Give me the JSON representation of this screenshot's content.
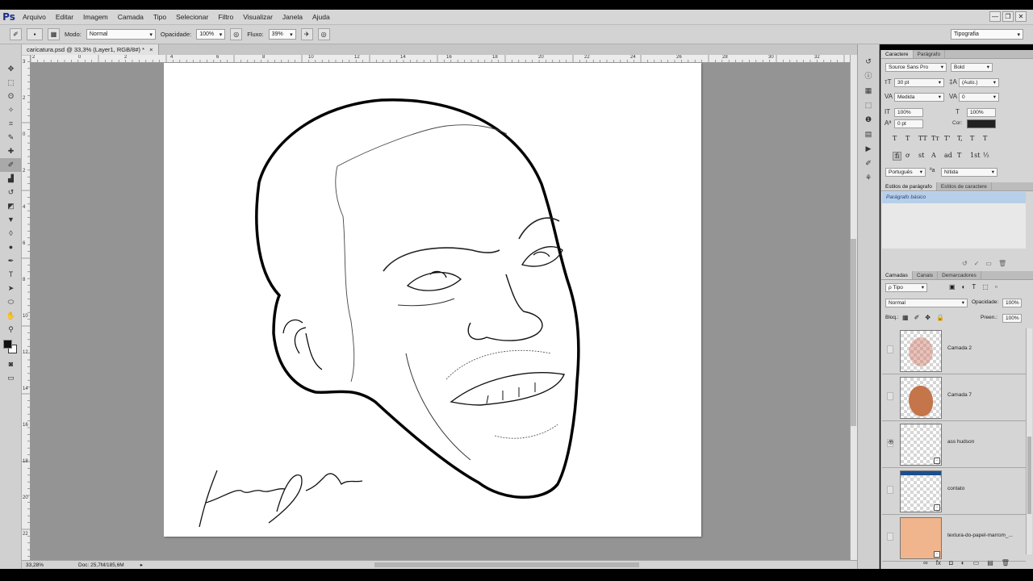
{
  "app": {
    "logo": "Ps"
  },
  "menu": [
    "Arquivo",
    "Editar",
    "Imagem",
    "Camada",
    "Tipo",
    "Selecionar",
    "Filtro",
    "Visualizar",
    "Janela",
    "Ajuda"
  ],
  "window_controls": [
    "—",
    "❐",
    "✕"
  ],
  "options_bar": {
    "mode_label": "Modo:",
    "mode_value": "Normal",
    "opacity_label": "Opacidade:",
    "opacity_value": "100%",
    "flow_label": "Fluxo:",
    "flow_value": "39%",
    "workspace": "Tipografia"
  },
  "document": {
    "tab_title": "caricatura.psd @ 33,3% (Layer1, RGB/8#) *",
    "zoom": "33,28%",
    "doc_info": "Doc: 25,7M/185,6M"
  },
  "ruler_top_labels": [
    "2",
    "0",
    "2",
    "4",
    "6",
    "8",
    "10",
    "12",
    "14",
    "16",
    "18",
    "20",
    "22",
    "24",
    "26",
    "28",
    "30",
    "32"
  ],
  "ruler_left_labels": [
    "3",
    "2",
    "0",
    "2",
    "4",
    "6",
    "8",
    "10",
    "12",
    "14",
    "16",
    "18",
    "20",
    "22"
  ],
  "tools": [
    {
      "name": "move-tool",
      "glyph": "✥"
    },
    {
      "name": "marquee-tool",
      "glyph": "⬚"
    },
    {
      "name": "lasso-tool",
      "glyph": "ʘ"
    },
    {
      "name": "quick-select-tool",
      "glyph": "✧"
    },
    {
      "name": "crop-tool",
      "glyph": "⌗"
    },
    {
      "name": "eyedropper-tool",
      "glyph": "✎"
    },
    {
      "name": "healing-tool",
      "glyph": "✚"
    },
    {
      "name": "brush-tool",
      "glyph": "✐"
    },
    {
      "name": "stamp-tool",
      "glyph": "▟"
    },
    {
      "name": "history-brush-tool",
      "glyph": "↺"
    },
    {
      "name": "eraser-tool",
      "glyph": "◩"
    },
    {
      "name": "paint-bucket-tool",
      "glyph": "▼"
    },
    {
      "name": "blur-tool",
      "glyph": "◊"
    },
    {
      "name": "dodge-tool",
      "glyph": "●"
    },
    {
      "name": "pen-tool",
      "glyph": "✒"
    },
    {
      "name": "type-tool",
      "glyph": "T"
    },
    {
      "name": "path-select-tool",
      "glyph": "➤"
    },
    {
      "name": "shape-tool",
      "glyph": "⬭"
    },
    {
      "name": "hand-tool",
      "glyph": "✋"
    },
    {
      "name": "zoom-tool",
      "glyph": "⚲"
    }
  ],
  "character_panel": {
    "tabs": [
      "Caractere",
      "Parágrafo"
    ],
    "font_family": "Source Sans Pro",
    "font_style": "Bold",
    "font_size": "30 pt",
    "leading": "(Auto.)",
    "kerning": "Medida",
    "tracking": "0",
    "vertical_scale": "100%",
    "horizontal_scale": "100%",
    "baseline_shift": "0 pt",
    "color_label": "Cor:",
    "color": "#222222",
    "style_buttons": [
      "T",
      "T",
      "TT",
      "Tт",
      "T'",
      "T,",
      "T",
      "T"
    ],
    "opentype_buttons": [
      "fi",
      "ơ",
      "st",
      "A",
      "ad",
      "T",
      "1st",
      "½"
    ],
    "language": "Português",
    "aa_symbol": "ªa",
    "antialias": "Nítida"
  },
  "paragraph_styles_panel": {
    "tabs": [
      "Estilos de parágrafo",
      "Estilos de caractere"
    ],
    "items": [
      "Parágrafo básico"
    ]
  },
  "layers_panel": {
    "tabs": [
      "Camadas",
      "Canais",
      "Demarcadores"
    ],
    "filter": "ρ Tipo",
    "blend_mode": "Normal",
    "opacity_label": "Opacidade:",
    "opacity_value": "100%",
    "lock_label": "Bloq.:",
    "fill_label": "Preen.:",
    "fill_value": "100%",
    "layers": [
      {
        "name": "Camada 2",
        "visible": false,
        "thumb": "sketch"
      },
      {
        "name": "Camada 7",
        "visible": false,
        "thumb": "skin"
      },
      {
        "name": "ass hudson",
        "visible": true,
        "thumb": "blank"
      },
      {
        "name": "contato",
        "visible": false,
        "thumb": "banner"
      },
      {
        "name": "textura-do-papel-marrom_...",
        "visible": false,
        "thumb": "paper"
      }
    ],
    "footer_icons": [
      "∞",
      "fx",
      "◘",
      "◐",
      "▭",
      "▤",
      "🗑"
    ]
  },
  "colors": {
    "fg": "#111111",
    "bg": "#ffffff",
    "skin": "#c47549",
    "paper_texture": "#f0b58c",
    "selection": "#b7cfe9"
  }
}
